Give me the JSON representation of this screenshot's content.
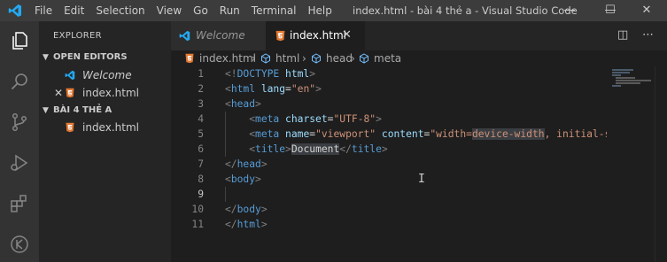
{
  "window": {
    "title": "index.html - bài 4 thẻ a - Visual Studio Code",
    "menu": [
      "File",
      "Edit",
      "Selection",
      "View",
      "Go",
      "Run",
      "Terminal",
      "Help"
    ],
    "controls": {
      "minimize": "—",
      "maximize": "☐",
      "close": "✕"
    }
  },
  "sidebar": {
    "title": "EXPLORER",
    "open_editors": {
      "label": "OPEN EDITORS",
      "items": [
        {
          "label": "Welcome",
          "close": ""
        },
        {
          "label": "index.html",
          "close": "✕"
        }
      ]
    },
    "folder": {
      "label": "BÀI 4 THẺ A",
      "items": [
        {
          "label": "index.html"
        }
      ]
    }
  },
  "tabs": [
    {
      "label": "Welcome",
      "active": false
    },
    {
      "label": "index.html",
      "active": true,
      "close": "✕"
    }
  ],
  "editor_actions": {
    "split": "◫",
    "more": "⋯"
  },
  "breadcrumb": {
    "items": [
      "index.html",
      "html",
      "head",
      "meta"
    ],
    "separator": "›"
  },
  "editor": {
    "line_numbers": [
      "1",
      "2",
      "3",
      "4",
      "5",
      "6",
      "7",
      "8",
      "9",
      "10",
      "11"
    ],
    "lines": [
      [
        {
          "c": "p",
          "t": "<!"
        },
        {
          "c": "t",
          "t": "DOCTYPE"
        },
        {
          "c": "a",
          "t": " html"
        },
        {
          "c": "p",
          "t": ">"
        }
      ],
      [
        {
          "c": "p",
          "t": "<"
        },
        {
          "c": "t",
          "t": "html"
        },
        {
          "c": "a",
          "t": " lang"
        },
        {
          "c": "tx",
          "t": "="
        },
        {
          "c": "s",
          "t": "\"en\""
        },
        {
          "c": "p",
          "t": ">"
        }
      ],
      [
        {
          "c": "p",
          "t": "<"
        },
        {
          "c": "t",
          "t": "head"
        },
        {
          "c": "p",
          "t": ">"
        }
      ],
      [
        {
          "c": "tx",
          "t": "    "
        },
        {
          "c": "p",
          "t": "<"
        },
        {
          "c": "t",
          "t": "meta"
        },
        {
          "c": "a",
          "t": " charset"
        },
        {
          "c": "tx",
          "t": "="
        },
        {
          "c": "s",
          "t": "\"UTF-8\""
        },
        {
          "c": "p",
          "t": ">"
        }
      ],
      [
        {
          "c": "tx",
          "t": "    "
        },
        {
          "c": "p",
          "t": "<"
        },
        {
          "c": "t",
          "t": "meta"
        },
        {
          "c": "a",
          "t": " name"
        },
        {
          "c": "tx",
          "t": "="
        },
        {
          "c": "s",
          "t": "\"viewport\""
        },
        {
          "c": "a",
          "t": " content"
        },
        {
          "c": "tx",
          "t": "="
        },
        {
          "c": "s",
          "t": "\"width="
        },
        {
          "c": "s hl",
          "t": "device-width"
        },
        {
          "c": "s",
          "t": ", initial-s"
        }
      ],
      [
        {
          "c": "tx",
          "t": "    "
        },
        {
          "c": "p",
          "t": "<"
        },
        {
          "c": "t",
          "t": "title"
        },
        {
          "c": "p",
          "t": ">"
        },
        {
          "c": "tx hl",
          "t": "Document"
        },
        {
          "c": "p",
          "t": "</"
        },
        {
          "c": "t",
          "t": "title"
        },
        {
          "c": "p",
          "t": ">"
        }
      ],
      [
        {
          "c": "p",
          "t": "</"
        },
        {
          "c": "t",
          "t": "head"
        },
        {
          "c": "p",
          "t": ">"
        }
      ],
      [
        {
          "c": "p",
          "t": "<"
        },
        {
          "c": "t",
          "t": "body"
        },
        {
          "c": "p",
          "t": ">"
        }
      ],
      [
        {
          "c": "tx",
          "t": "    "
        }
      ],
      [
        {
          "c": "p",
          "t": "</"
        },
        {
          "c": "t",
          "t": "body"
        },
        {
          "c": "p",
          "t": ">"
        }
      ],
      [
        {
          "c": "p",
          "t": "</"
        },
        {
          "c": "t",
          "t": "html"
        },
        {
          "c": "p",
          "t": ">"
        }
      ]
    ],
    "active_line": 9
  },
  "colors": {
    "activity_bar": "#333333",
    "sidebar": "#252526",
    "editor_bg": "#1e1e1e",
    "html_icon": "#e37933",
    "vscode_blue": "#23a9f2",
    "tag": "#569cd6",
    "attr": "#9cdcfe",
    "string": "#ce9178"
  },
  "icons": {
    "activity": [
      "explorer-icon",
      "search-icon",
      "source-control-icon",
      "run-debug-icon",
      "extensions-icon",
      "remote-icon"
    ]
  }
}
